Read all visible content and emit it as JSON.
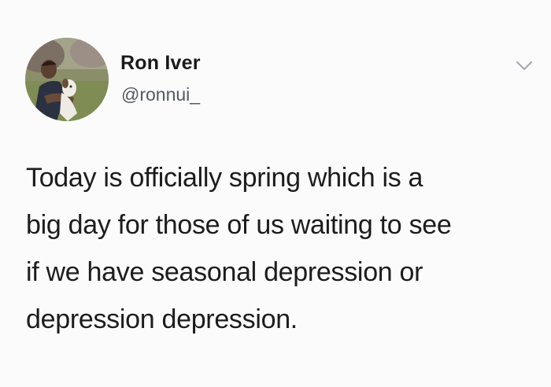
{
  "author": {
    "display_name": "Ron Iver",
    "handle": "@ronnui_",
    "avatar_icon": "profile-photo"
  },
  "tweet": {
    "lines": [
      "Today is officially spring which is a",
      "big day for those of us waiting to see",
      "if we have seasonal depression or",
      "depression depression."
    ]
  },
  "menu_icon": "chevron-down-icon"
}
